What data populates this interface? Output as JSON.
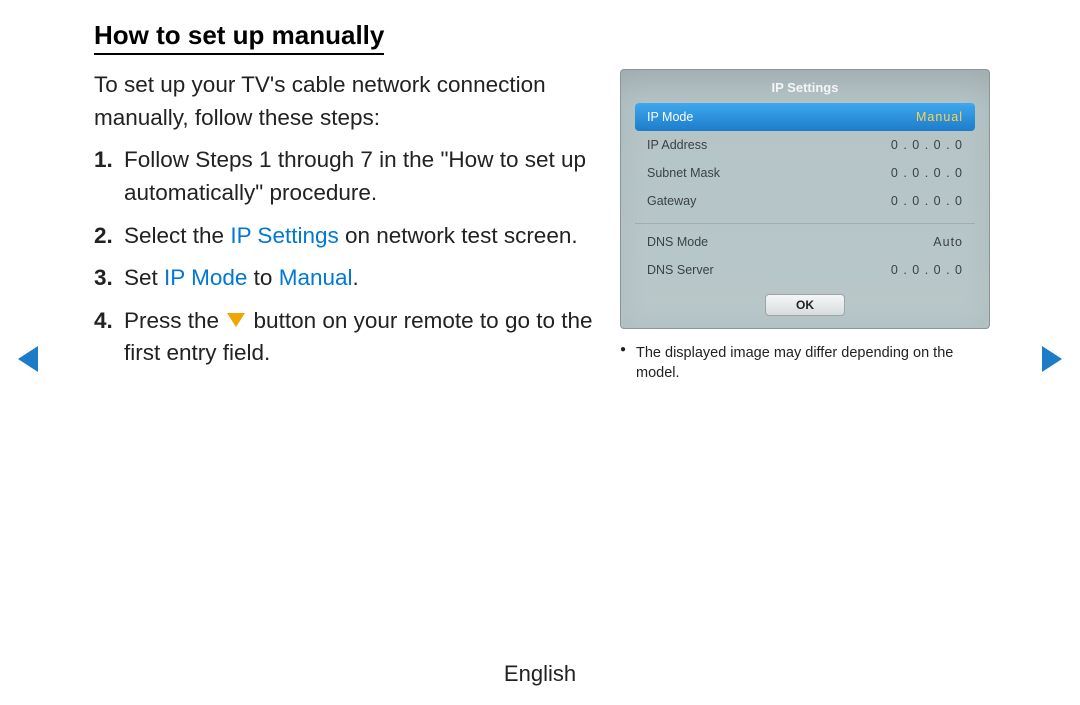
{
  "title": "How to set up manually",
  "intro": "To set up your TV's cable network connection manually, follow these steps:",
  "steps": {
    "s1": {
      "num": "1.",
      "text": "Follow Steps 1 through 7 in the \"How to set up automatically\" procedure."
    },
    "s2": {
      "num": "2.",
      "pre": "Select the ",
      "hl": "IP Settings",
      "post": " on network test screen."
    },
    "s3": {
      "num": "3.",
      "pre": "Set ",
      "hl1": "IP Mode",
      "mid": " to ",
      "hl2": "Manual",
      "post": "."
    },
    "s4": {
      "num": "4.",
      "pre": "Press the ",
      "post": " button on your remote to go to the first entry field."
    }
  },
  "panel": {
    "title": "IP Settings",
    "rows": [
      {
        "label": "IP Mode",
        "value": "Manual"
      },
      {
        "label": "IP Address",
        "value": "0 . 0 . 0 . 0"
      },
      {
        "label": "Subnet Mask",
        "value": "0 . 0 . 0 . 0"
      },
      {
        "label": "Gateway",
        "value": "0 . 0 . 0 . 0"
      }
    ],
    "rows2": [
      {
        "label": "DNS Mode",
        "value": "Auto"
      },
      {
        "label": "DNS Server",
        "value": "0 . 0 . 0 . 0"
      }
    ],
    "ok": "OK"
  },
  "caption": "The displayed image may differ depending on the model.",
  "footer": "English"
}
